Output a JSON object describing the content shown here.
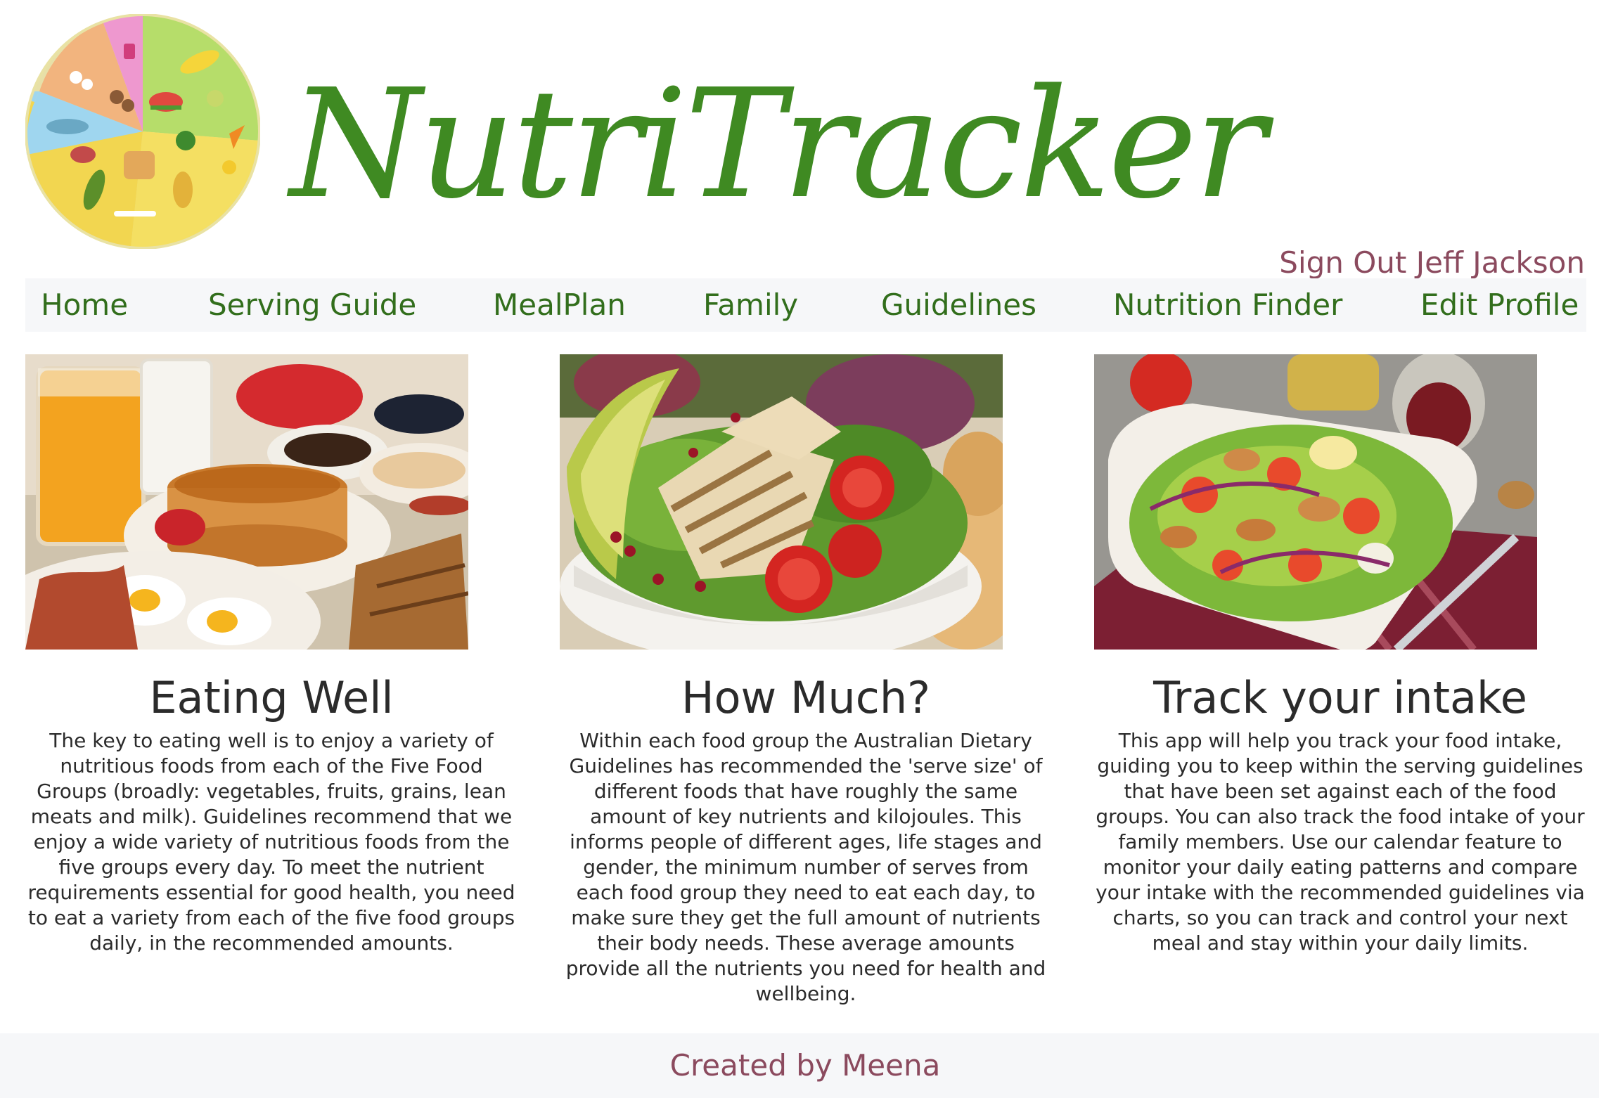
{
  "header": {
    "brand_name": "NutriTracker",
    "signout_label": "Sign Out Jeff Jackson"
  },
  "nav": {
    "items": [
      {
        "label": "Home"
      },
      {
        "label": "Serving Guide"
      },
      {
        "label": "MealPlan"
      },
      {
        "label": "Family"
      },
      {
        "label": "Guidelines"
      },
      {
        "label": "Nutrition Finder"
      },
      {
        "label": "Edit Profile"
      }
    ]
  },
  "features": [
    {
      "image": "breakfast-photo",
      "title": "Eating Well",
      "body": "The key to eating well is to enjoy a variety of nutritious foods from each of the Five Food Groups (broadly: vegetables, fruits, grains, lean meats and milk). Guidelines recommend that we enjoy a wide variety of nutritious foods from the five groups every day. To meet the nutrient requirements essential for good health, you need to eat a variety from each of the five food groups daily, in the recommended amounts."
    },
    {
      "image": "chicken-salad-photo",
      "title": "How Much?",
      "body": "Within each food group the Australian Dietary Guidelines has recommended the 'serve size' of different foods that have roughly the same amount of key nutrients and kilojoules. This informs people of different ages, life stages and gender, the minimum number of serves from each food group they need to eat each day, to make sure they get the full amount of nutrients their body needs. These average amounts provide all the nutrients you need for health and wellbeing."
    },
    {
      "image": "walnut-salad-photo",
      "title": "Track your intake",
      "body": "This app will help you track your food intake, guiding you to keep within the serving guidelines that have been set against each of the food groups. You can also track the food intake of your family members. Use our calendar feature to monitor your daily eating patterns and compare your intake with the recommended guidelines via charts, so you can track and control your next meal and stay within your daily limits."
    }
  ],
  "footer": {
    "text": "Created by Meena"
  },
  "colors": {
    "brand_green": "#3f8a22",
    "nav_green": "#326e1c",
    "accent_plum": "#8b4a5e",
    "bar_bg": "#f6f7f9"
  }
}
